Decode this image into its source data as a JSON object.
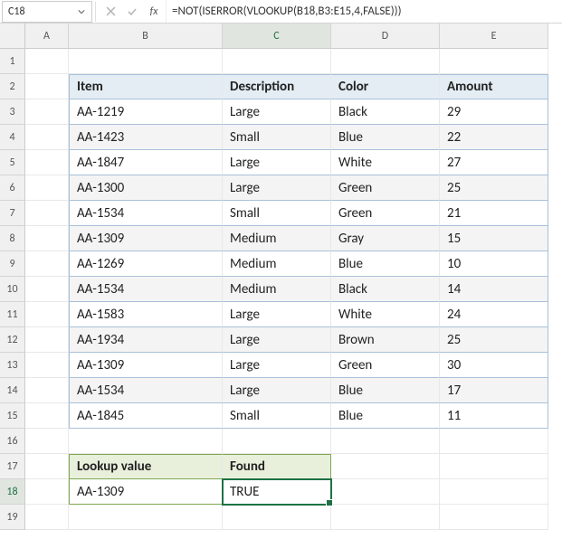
{
  "formula_bar": {
    "cell_ref": "C18",
    "formula": "=NOT(ISERROR(VLOOKUP(B18,B3:E15,4,FALSE)))"
  },
  "columns": [
    "A",
    "B",
    "C",
    "D",
    "E"
  ],
  "row_count": 19,
  "table": {
    "headers": {
      "item": "Item",
      "desc": "Description",
      "color": "Color",
      "amount": "Amount"
    },
    "rows": [
      {
        "item": "AA-1219",
        "desc": "Large",
        "color": "Black",
        "amount": "29"
      },
      {
        "item": "AA-1423",
        "desc": "Small",
        "color": "Blue",
        "amount": "22"
      },
      {
        "item": "AA-1847",
        "desc": "Large",
        "color": "White",
        "amount": "27"
      },
      {
        "item": "AA-1300",
        "desc": "Large",
        "color": "Green",
        "amount": "25"
      },
      {
        "item": "AA-1534",
        "desc": "Small",
        "color": "Green",
        "amount": "21"
      },
      {
        "item": "AA-1309",
        "desc": "Medium",
        "color": "Gray",
        "amount": "15"
      },
      {
        "item": "AA-1269",
        "desc": "Medium",
        "color": "Blue",
        "amount": "10"
      },
      {
        "item": "AA-1534",
        "desc": "Medium",
        "color": "Black",
        "amount": "14"
      },
      {
        "item": "AA-1583",
        "desc": "Large",
        "color": "White",
        "amount": "24"
      },
      {
        "item": "AA-1934",
        "desc": "Large",
        "color": "Brown",
        "amount": "25"
      },
      {
        "item": "AA-1309",
        "desc": "Large",
        "color": "Green",
        "amount": "30"
      },
      {
        "item": "AA-1534",
        "desc": "Large",
        "color": "Blue",
        "amount": "17"
      },
      {
        "item": "AA-1845",
        "desc": "Small",
        "color": "Blue",
        "amount": "11"
      }
    ]
  },
  "lookup": {
    "headers": {
      "value": "Lookup value",
      "found": "Found"
    },
    "value": "AA-1309",
    "found": "TRUE"
  },
  "active_cell": {
    "row": 18,
    "col": "C"
  }
}
